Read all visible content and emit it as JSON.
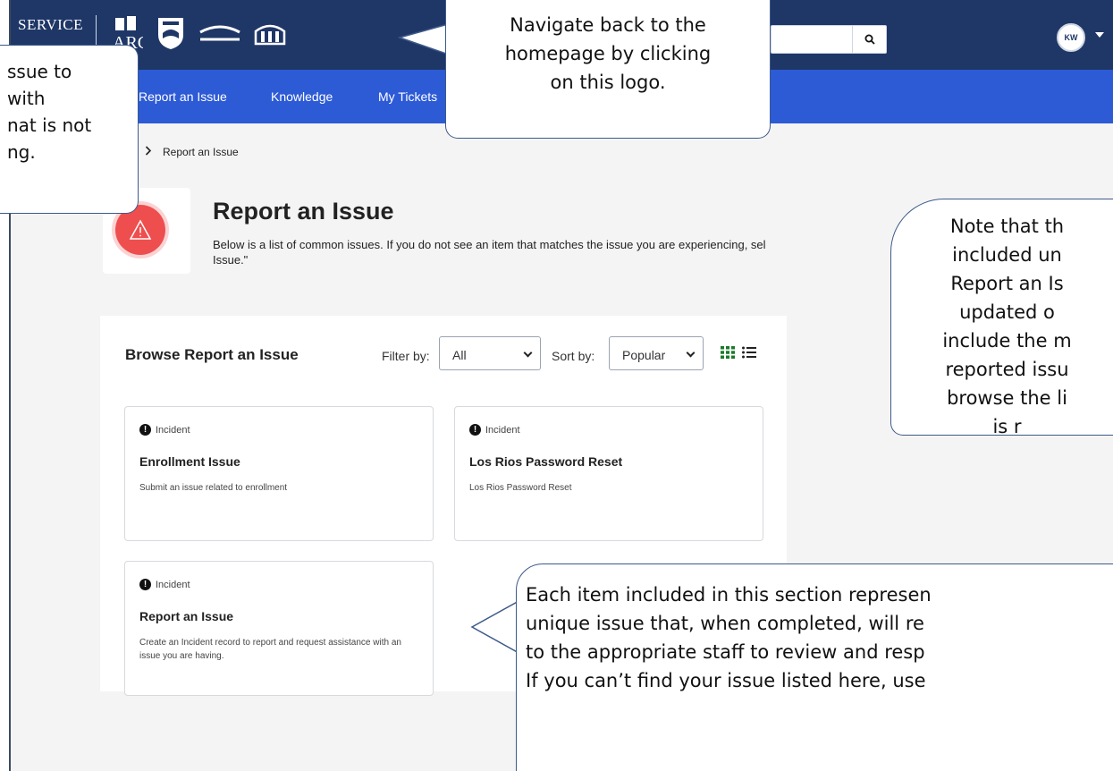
{
  "header": {
    "logo_text_line1": "SERVICE",
    "logo_arc_text": "ARC",
    "search_placeholder": "",
    "avatar_initials": "KW"
  },
  "nav": {
    "items": [
      {
        "label": "Report an Issue"
      },
      {
        "label": "Knowledge"
      },
      {
        "label": "My Tickets"
      }
    ]
  },
  "breadcrumb": {
    "current": "Report an Issue"
  },
  "page": {
    "title": "Report an Issue",
    "description_line1": "Below is a list of common issues. If you do not see an item that matches the issue you are experiencing, sel",
    "description_line2": "Issue.\""
  },
  "browse": {
    "title": "Browse Report an Issue",
    "filter_label": "Filter by:",
    "filter_value": "All",
    "sort_label": "Sort by:",
    "sort_value": "Popular",
    "cards": [
      {
        "type": "Incident",
        "title": "Enrollment Issue",
        "description": "Submit an issue related to enrollment"
      },
      {
        "type": "Incident",
        "title": "Los Rios Password Reset",
        "description": "Los Rios Password Reset"
      },
      {
        "type": "Incident",
        "title": "Report an Issue",
        "description": "Create an Incident record to report and request assistance with an issue you are having."
      }
    ]
  },
  "callouts": {
    "left": "ssue to\n with\nnat is not\nng.",
    "top": "Navigate back to the\nhomepage by clicking\non this logo.",
    "right": "Note that th\nincluded un\nReport an Is\nupdated o\ninclude the m\nreported issu\nbrowse the li\nis r",
    "bottom": "Each item included in this section represen\nunique issue that, when completed, will re\nto the appropriate staff to review and resp\nIf you can’t find your issue listed here, use"
  },
  "colors": {
    "header_bg": "#1f3767",
    "nav_bg": "#2d5bd6",
    "alert_icon": "#ee4e4e",
    "callout_border": "#3d5a8a"
  }
}
